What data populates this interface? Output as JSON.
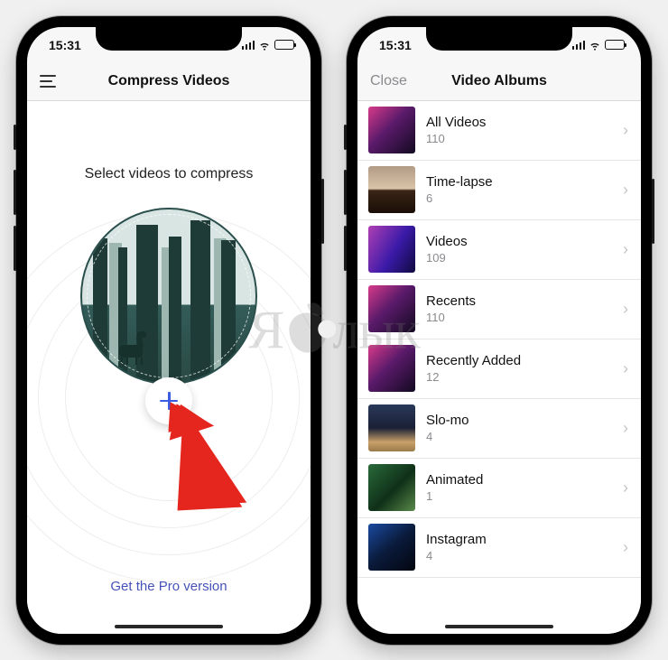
{
  "status": {
    "time": "15:31"
  },
  "left_phone": {
    "nav_title": "Compress Videos",
    "prompt": "Select videos to compress",
    "pro_link": "Get the Pro version"
  },
  "right_phone": {
    "nav_title": "Video Albums",
    "close_label": "Close",
    "albums": [
      {
        "name": "All Videos",
        "count": "110"
      },
      {
        "name": "Time-lapse",
        "count": "6"
      },
      {
        "name": "Videos",
        "count": "109"
      },
      {
        "name": "Recents",
        "count": "110"
      },
      {
        "name": "Recently Added",
        "count": "12"
      },
      {
        "name": "Slo-mo",
        "count": "4"
      },
      {
        "name": "Animated",
        "count": "1"
      },
      {
        "name": "Instagram",
        "count": "4"
      }
    ]
  },
  "watermark": {
    "left": "Я",
    "right": "лык"
  }
}
